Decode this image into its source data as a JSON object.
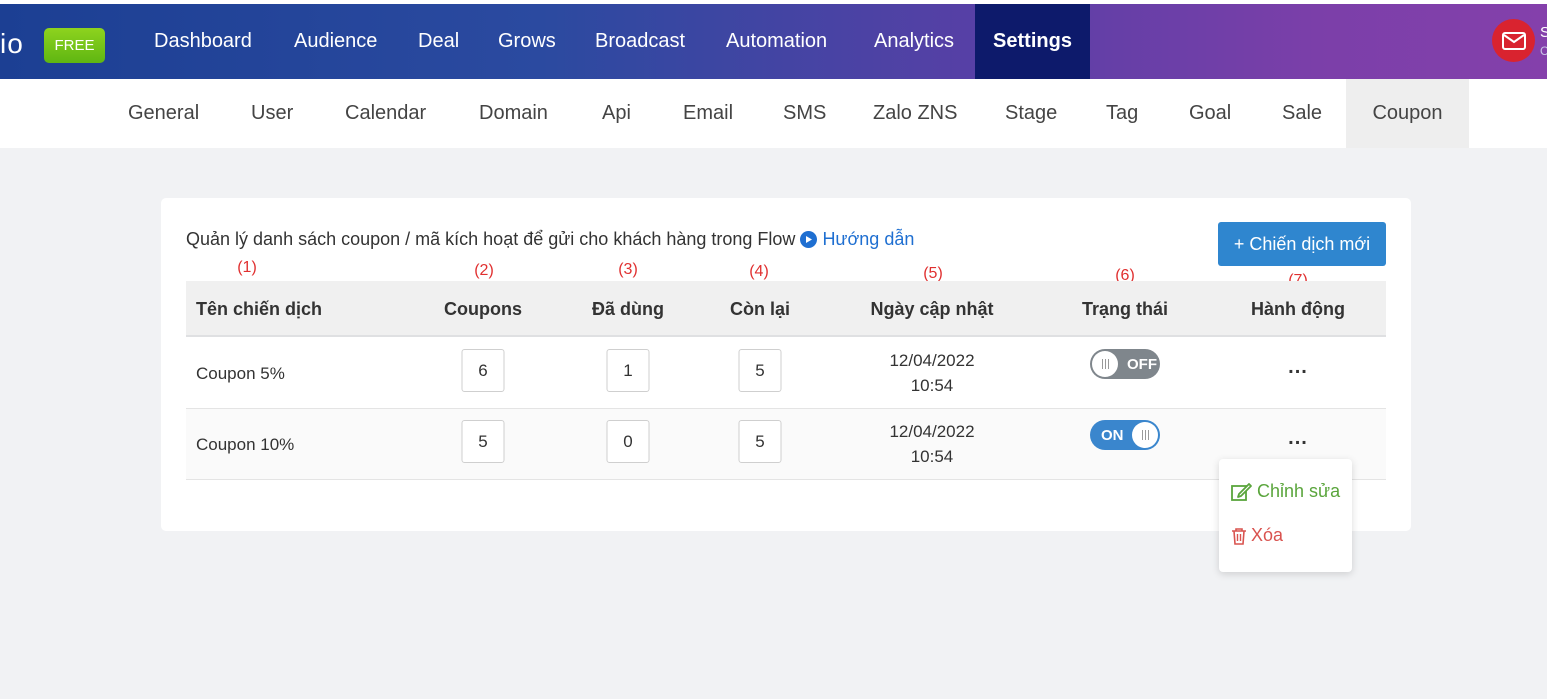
{
  "topbar": {
    "logo_fragment": "io",
    "plan_badge": "FREE",
    "nav": [
      {
        "label": "Dashboard"
      },
      {
        "label": "Audience"
      },
      {
        "label": "Deal"
      },
      {
        "label": "Grows"
      },
      {
        "label": "Broadcast"
      },
      {
        "label": "Automation"
      },
      {
        "label": "Analytics"
      },
      {
        "label": "Settings",
        "active": true
      }
    ],
    "mail_icon": "mail-icon",
    "user_fragment": "S",
    "user_sub_fragment": "C"
  },
  "subnav": {
    "items": [
      {
        "label": "General"
      },
      {
        "label": "User"
      },
      {
        "label": "Calendar"
      },
      {
        "label": "Domain"
      },
      {
        "label": "Api"
      },
      {
        "label": "Email"
      },
      {
        "label": "SMS"
      },
      {
        "label": "Zalo ZNS"
      },
      {
        "label": "Stage"
      },
      {
        "label": "Tag"
      },
      {
        "label": "Goal"
      },
      {
        "label": "Sale"
      },
      {
        "label": "Coupon",
        "active": true
      }
    ]
  },
  "coupon_page": {
    "description": "Quản lý danh sách coupon / mã kích hoạt để gửi cho khách hàng trong Flow",
    "guide_link": "Hướng dẫn",
    "new_campaign_button": "+ Chiến dịch mới",
    "annotations": [
      "(1)",
      "(2)",
      "(3)",
      "(4)",
      "(5)",
      "(6)",
      "(7)"
    ],
    "table": {
      "headers": [
        "Tên chiến dịch",
        "Coupons",
        "Đã dùng",
        "Còn lại",
        "Ngày cập nhật",
        "Trạng thái",
        "Hành động"
      ],
      "rows": [
        {
          "name": "Coupon 5%",
          "coupons": "6",
          "used": "1",
          "remaining": "5",
          "date": "12/04/2022",
          "time": "10:54",
          "status": "OFF",
          "status_on": false,
          "action": "..."
        },
        {
          "name": "Coupon 10%",
          "coupons": "5",
          "used": "0",
          "remaining": "5",
          "date": "12/04/2022",
          "time": "10:54",
          "status": "ON",
          "status_on": true,
          "action": "..."
        }
      ]
    },
    "action_menu": {
      "edit": "Chỉnh sửa",
      "delete": "Xóa"
    }
  },
  "colors": {
    "accent_blue": "#2f86cf",
    "free_badge": "#6cc417",
    "active_nav": "#0d1a6b",
    "annotation_red": "#e03030",
    "edit_green": "#5aa53c",
    "delete_red": "#d9534f"
  }
}
